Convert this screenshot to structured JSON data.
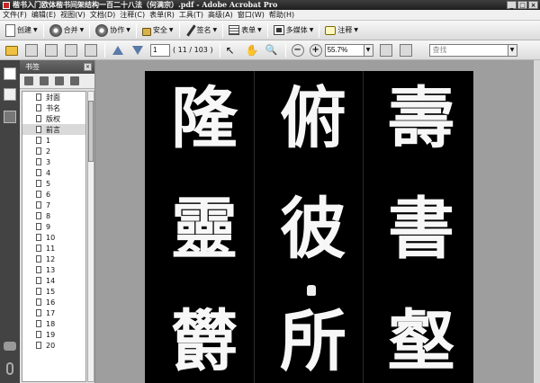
{
  "window": {
    "title": "楷书入门欧体楷书间架结构一百二十八法（何满宗）.pdf - Adobe Acrobat Pro",
    "controls": [
      "_",
      "□",
      "×"
    ]
  },
  "menu": [
    "文件(F)",
    "编辑(E)",
    "视图(V)",
    "文档(D)",
    "注释(C)",
    "表单(R)",
    "工具(T)",
    "高级(A)",
    "窗口(W)",
    "帮助(H)"
  ],
  "toolbar1": {
    "create": "创建",
    "combine": "合并",
    "collaborate": "协作",
    "secure": "安全",
    "sign": "签名",
    "forms": "表单",
    "multimedia": "多媒体",
    "comment": "注释"
  },
  "toolbar2": {
    "page_number": "1",
    "page_count": "( 11 / 103 )",
    "zoom": "55.7%",
    "search_placeholder": "查找"
  },
  "bookmarks": {
    "title": "书签",
    "items": [
      "封面",
      "书名",
      "版权",
      "前言",
      "1",
      "2",
      "3",
      "4",
      "5",
      "6",
      "7",
      "8",
      "9",
      "10",
      "11",
      "12",
      "13",
      "14",
      "15",
      "16",
      "17",
      "18",
      "19",
      "20"
    ],
    "selected_index": 3
  },
  "document": {
    "characters": [
      "壽",
      "俯",
      "隆",
      "書",
      "彼",
      "靈",
      "壑",
      "所",
      "欝"
    ]
  }
}
